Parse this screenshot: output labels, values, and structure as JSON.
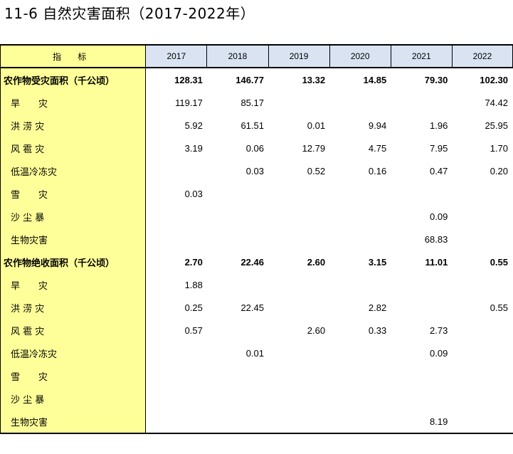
{
  "title": "11-6 自然灾害面积（2017-2022年）",
  "colors": {
    "label_bg": "#ffff99",
    "header_bg": "#d9e3f2"
  },
  "table": {
    "header_indicator": "指 标",
    "years": [
      "2017",
      "2018",
      "2019",
      "2020",
      "2021",
      "2022"
    ],
    "rows": [
      {
        "label": "农作物受灾面积（千公顷）",
        "group": true,
        "values": [
          "128.31",
          "146.77",
          "13.32",
          "14.85",
          "79.30",
          "102.30"
        ]
      },
      {
        "label": "旱　　灾",
        "group": false,
        "values": [
          "119.17",
          "85.17",
          "",
          "",
          "",
          "74.42"
        ]
      },
      {
        "label": "洪 涝 灾",
        "group": false,
        "values": [
          "5.92",
          "61.51",
          "0.01",
          "9.94",
          "1.96",
          "25.95"
        ]
      },
      {
        "label": "风 雹 灾",
        "group": false,
        "values": [
          "3.19",
          "0.06",
          "12.79",
          "4.75",
          "7.95",
          "1.70"
        ]
      },
      {
        "label": "低温冷冻灾",
        "group": false,
        "values": [
          "",
          "0.03",
          "0.52",
          "0.16",
          "0.47",
          "0.20"
        ]
      },
      {
        "label": "雪　　灾",
        "group": false,
        "values": [
          "0.03",
          "",
          "",
          "",
          "",
          ""
        ]
      },
      {
        "label": "沙 尘 暴",
        "group": false,
        "values": [
          "",
          "",
          "",
          "",
          "0.09",
          ""
        ]
      },
      {
        "label": "生物灾害",
        "group": false,
        "values": [
          "",
          "",
          "",
          "",
          "68.83",
          ""
        ]
      },
      {
        "label": "农作物绝收面积（千公顷）",
        "group": true,
        "values": [
          "2.70",
          "22.46",
          "2.60",
          "3.15",
          "11.01",
          "0.55"
        ]
      },
      {
        "label": "旱　　灾",
        "group": false,
        "values": [
          "1.88",
          "",
          "",
          "",
          "",
          ""
        ]
      },
      {
        "label": "洪 涝 灾",
        "group": false,
        "values": [
          "0.25",
          "22.45",
          "",
          "2.82",
          "",
          "0.55"
        ]
      },
      {
        "label": "风 雹 灾",
        "group": false,
        "values": [
          "0.57",
          "",
          "2.60",
          "0.33",
          "2.73",
          ""
        ]
      },
      {
        "label": "低温冷冻灾",
        "group": false,
        "values": [
          "",
          "0.01",
          "",
          "",
          "0.09",
          ""
        ]
      },
      {
        "label": "雪　　灾",
        "group": false,
        "values": [
          "",
          "",
          "",
          "",
          "",
          ""
        ]
      },
      {
        "label": "沙 尘 暴",
        "group": false,
        "values": [
          "",
          "",
          "",
          "",
          "",
          ""
        ]
      },
      {
        "label": "生物灾害",
        "group": false,
        "values": [
          "",
          "",
          "",
          "",
          "8.19",
          ""
        ]
      }
    ]
  }
}
